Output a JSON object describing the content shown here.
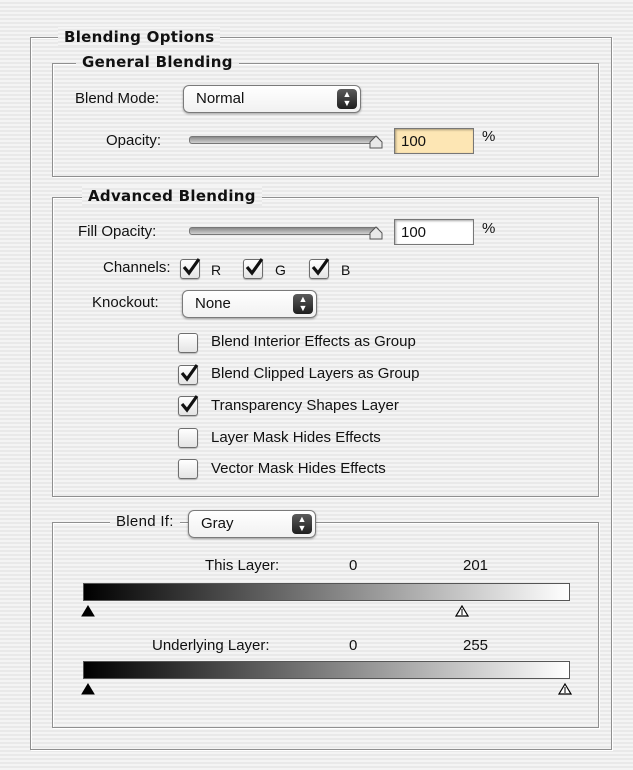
{
  "blending_options": {
    "title": "Blending Options"
  },
  "general": {
    "title": "General Blending",
    "blend_mode_label": "Blend Mode:",
    "blend_mode_value": "Normal",
    "opacity_label": "Opacity:",
    "opacity_value": "100",
    "opacity_unit": "%",
    "opacity_slider_fraction": 1.0
  },
  "advanced": {
    "title": "Advanced Blending",
    "fill_opacity_label": "Fill Opacity:",
    "fill_opacity_value": "100",
    "fill_opacity_unit": "%",
    "fill_opacity_slider_fraction": 1.0,
    "channels_label": "Channels:",
    "channels": [
      {
        "label": "R",
        "checked": true
      },
      {
        "label": "G",
        "checked": true
      },
      {
        "label": "B",
        "checked": true
      }
    ],
    "knockout_label": "Knockout:",
    "knockout_value": "None",
    "options": [
      {
        "label": "Blend Interior Effects as Group",
        "checked": false
      },
      {
        "label": "Blend Clipped Layers as Group",
        "checked": true
      },
      {
        "label": "Transparency Shapes Layer",
        "checked": true
      },
      {
        "label": "Layer Mask Hides Effects",
        "checked": false
      },
      {
        "label": "Vector Mask Hides Effects",
        "checked": false
      }
    ]
  },
  "blend_if": {
    "label": "Blend If:",
    "value": "Gray",
    "this_layer": {
      "label": "This Layer:",
      "low": "0",
      "high": "201"
    },
    "underlying_layer": {
      "label": "Underlying Layer:",
      "low": "0",
      "high": "255"
    }
  },
  "icons": {
    "select_arrows": "up-down-arrows-icon",
    "checkmark": "checkmark-icon",
    "slider_thumb": "slider-thumb-icon",
    "range_black": "black-triangle-icon",
    "range_white": "white-triangle-icon"
  }
}
